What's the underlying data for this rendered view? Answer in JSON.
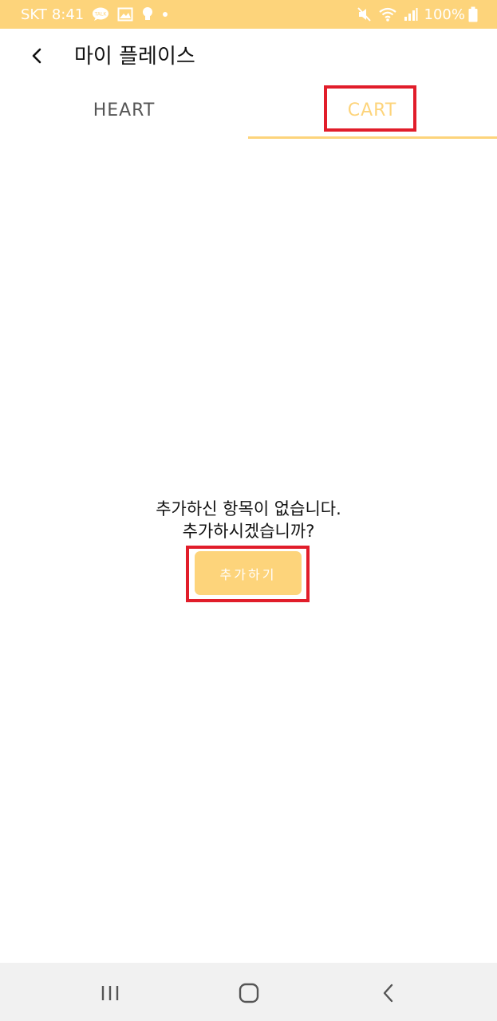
{
  "status_bar": {
    "carrier": "SKT",
    "time": "8:41",
    "battery": "100%",
    "icons": [
      "talk-icon",
      "gallery-icon",
      "bulb-icon",
      "dot-icon",
      "mute-icon",
      "wifi-icon",
      "signal-icon",
      "battery-icon"
    ]
  },
  "header": {
    "title": "마이 플레이스",
    "back_icon": "chevron-left-icon"
  },
  "tabs": [
    {
      "label": "HEART",
      "selected": false
    },
    {
      "label": "CART",
      "selected": true
    }
  ],
  "empty_state": {
    "line1": "추가하신 항목이 없습니다.",
    "line2": "추가하시겠습니까?",
    "button_label": "추가하기"
  },
  "nav_bar": {
    "icons": [
      "recents-icon",
      "home-icon",
      "back-icon"
    ]
  },
  "colors": {
    "accent": "#fdd47b",
    "highlight_border": "#e11d2a",
    "nav_background": "#f1f1f1"
  }
}
